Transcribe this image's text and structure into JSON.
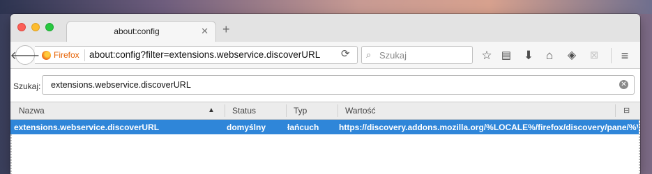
{
  "tab": {
    "title": "about:config"
  },
  "navbar": {
    "identity_label": "Firefox",
    "url": "about:config?filter=extensions.webservice.discoverURL",
    "search_placeholder": "Szukaj"
  },
  "filter": {
    "label": "Szukaj:",
    "value": "extensions.webservice.discoverURL"
  },
  "table": {
    "columns": [
      "Nazwa",
      "Status",
      "Typ",
      "Wartość"
    ],
    "sort_column": "Nazwa",
    "sort_direction": "ascending",
    "rows": [
      {
        "name": "extensions.webservice.discoverURL",
        "status": "domyślny",
        "type": "łańcuch",
        "value": "https://discovery.addons.mozilla.org/%LOCALE%/firefox/discovery/pane/%VERSI"
      }
    ]
  },
  "colors": {
    "selection": "#2f86d9",
    "firefox_accent": "#e66000"
  },
  "icons": [
    "back-arrow-icon",
    "firefox-logo-icon",
    "reload-icon",
    "search-icon",
    "bookmark-star-icon",
    "reading-list-icon",
    "download-icon",
    "home-icon",
    "pocket-icon",
    "screenshot-icon",
    "hamburger-menu-icon",
    "column-picker-icon",
    "clear-icon"
  ]
}
